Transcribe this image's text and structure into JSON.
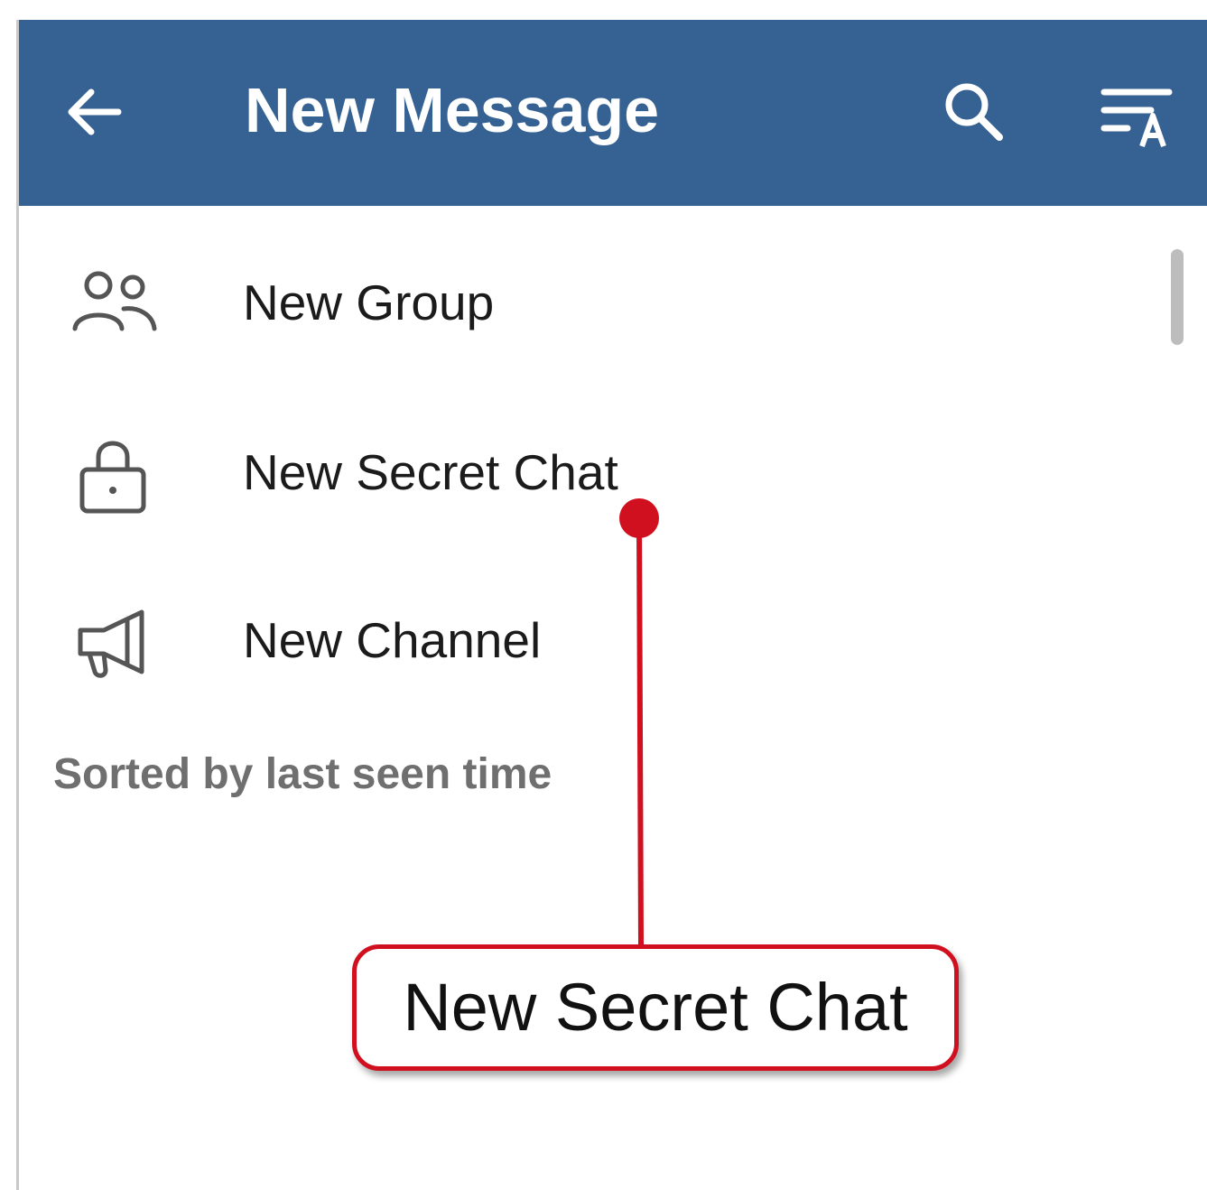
{
  "header": {
    "title": "New Message",
    "back_icon": "arrow-left-icon",
    "search_icon": "search-icon",
    "sort_icon": "sort-alpha-icon"
  },
  "menu": {
    "items": [
      {
        "label": "New Group",
        "icon": "group-icon"
      },
      {
        "label": "New Secret Chat",
        "icon": "lock-icon"
      },
      {
        "label": "New Channel",
        "icon": "megaphone-icon"
      }
    ]
  },
  "contacts": {
    "sort_caption": "Sorted by last seen time"
  },
  "annotation": {
    "label": "New Secret Chat"
  },
  "colors": {
    "appbar": "#356193",
    "callout": "#d1101f"
  }
}
